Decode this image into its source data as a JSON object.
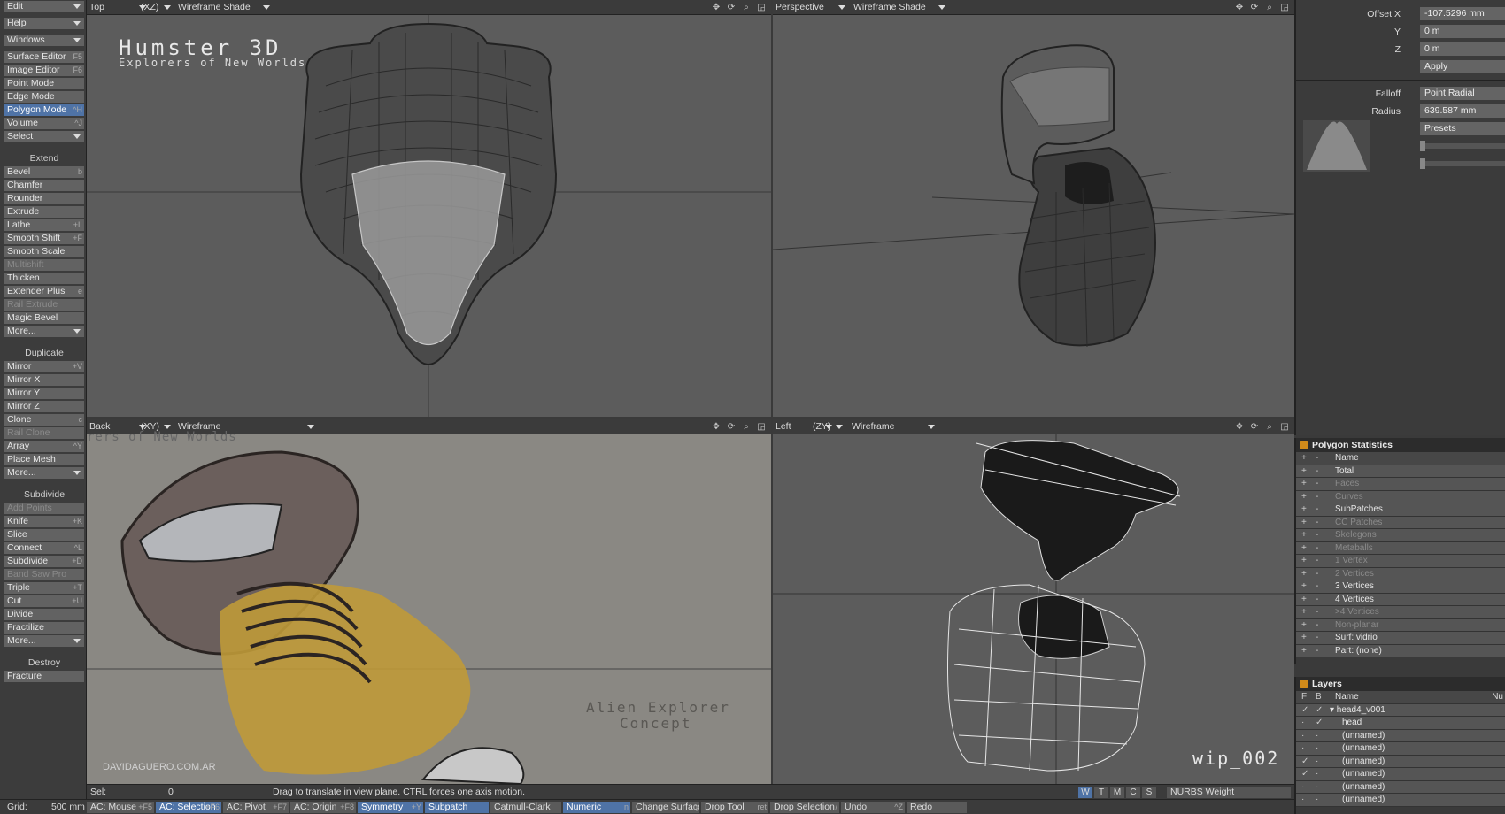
{
  "left_toolbar": {
    "items": [
      {
        "label": "Edit",
        "type": "dropdown"
      },
      {
        "label": "Help",
        "type": "dropdown"
      },
      {
        "label": "Windows",
        "type": "dropdown"
      },
      {
        "label": "Surface Editor",
        "shortcut": "F5"
      },
      {
        "label": "Image Editor",
        "shortcut": "F6"
      },
      {
        "label": "Point Mode",
        "shortcut": ""
      },
      {
        "label": "Edge Mode",
        "shortcut": ""
      },
      {
        "label": "Polygon Mode",
        "shortcut": "^H",
        "active": true
      },
      {
        "label": "Volume",
        "shortcut": "^J"
      },
      {
        "label": "Select",
        "type": "dropdown"
      },
      {
        "group": "Extend"
      },
      {
        "label": "Bevel",
        "shortcut": "b"
      },
      {
        "label": "Chamfer",
        "shortcut": ""
      },
      {
        "label": "Rounder",
        "shortcut": ""
      },
      {
        "label": "Extrude",
        "shortcut": ""
      },
      {
        "label": "Lathe",
        "shortcut": "+L"
      },
      {
        "label": "Smooth Shift",
        "shortcut": "+F"
      },
      {
        "label": "Smooth Scale",
        "shortcut": ""
      },
      {
        "label": "Multishift",
        "shortcut": "",
        "disabled": true
      },
      {
        "label": "Thicken",
        "shortcut": ""
      },
      {
        "label": "Extender Plus",
        "shortcut": "e"
      },
      {
        "label": "Rail Extrude",
        "shortcut": "",
        "disabled": true
      },
      {
        "label": "Magic Bevel",
        "shortcut": ""
      },
      {
        "label": "More...",
        "type": "dropdown"
      },
      {
        "group": "Duplicate"
      },
      {
        "label": "Mirror",
        "shortcut": "+V"
      },
      {
        "label": "Mirror X",
        "shortcut": ""
      },
      {
        "label": "Mirror Y",
        "shortcut": ""
      },
      {
        "label": "Mirror Z",
        "shortcut": ""
      },
      {
        "label": "Clone",
        "shortcut": "c"
      },
      {
        "label": "Rail Clone",
        "shortcut": "",
        "disabled": true
      },
      {
        "label": "Array",
        "shortcut": "^Y"
      },
      {
        "label": "Place Mesh",
        "shortcut": ""
      },
      {
        "label": "More...",
        "type": "dropdown"
      },
      {
        "group": "Subdivide"
      },
      {
        "label": "Add Points",
        "shortcut": "",
        "disabled": true
      },
      {
        "label": "Knife",
        "shortcut": "+K"
      },
      {
        "label": "Slice",
        "shortcut": ""
      },
      {
        "label": "Connect",
        "shortcut": "^L"
      },
      {
        "label": "Subdivide",
        "shortcut": "+D"
      },
      {
        "label": "Band Saw Pro",
        "shortcut": "",
        "disabled": true
      },
      {
        "label": "Triple",
        "shortcut": "+T"
      },
      {
        "label": "Cut",
        "shortcut": "+U"
      },
      {
        "label": "Divide",
        "shortcut": ""
      },
      {
        "label": "Fractilize",
        "shortcut": ""
      },
      {
        "label": "More...",
        "type": "dropdown"
      },
      {
        "group": "Destroy"
      },
      {
        "label": "Fracture",
        "shortcut": ""
      }
    ]
  },
  "viewports": {
    "top_left": {
      "name": "Top",
      "axes": "(XZ)",
      "shade": "Wireframe Shade",
      "title": "Humster 3D",
      "subtitle": "Explorers of New Worlds"
    },
    "top_right": {
      "name": "Perspective",
      "shade": "Wireframe Shade"
    },
    "bottom_left": {
      "name": "Back",
      "axes": "(XY)",
      "shade": "Wireframe",
      "watermark_top": "rers of New Worlds",
      "caption1": "Alien Explorer",
      "caption2": "Concept",
      "credit": "DAVIDAGUERO.COM.AR"
    },
    "bottom_right": {
      "name": "Left",
      "axes": "(ZY)",
      "shade": "Wireframe",
      "wip": "wip_002"
    }
  },
  "right_panel": {
    "offset_label": "Offset X",
    "offset_x": "-107.5296 mm",
    "y_label": "Y",
    "y": "0 m",
    "z_label": "Z",
    "z": "0 m",
    "apply": "Apply",
    "falloff_label": "Falloff",
    "falloff": "Point Radial",
    "radius_label": "Radius",
    "radius": "639.587 mm",
    "presets": "Presets"
  },
  "polygon_stats": {
    "title": "Polygon Statistics",
    "header": "Name",
    "rows": [
      {
        "name": "Total",
        "dim": false
      },
      {
        "name": "Faces",
        "dim": true
      },
      {
        "name": "Curves",
        "dim": true
      },
      {
        "name": "SubPatches",
        "dim": false
      },
      {
        "name": "CC Patches",
        "dim": true
      },
      {
        "name": "Skelegons",
        "dim": true
      },
      {
        "name": "Metaballs",
        "dim": true
      },
      {
        "name": "1 Vertex",
        "dim": true
      },
      {
        "name": "2 Vertices",
        "dim": true
      },
      {
        "name": "3 Vertices",
        "dim": false
      },
      {
        "name": "4 Vertices",
        "dim": false
      },
      {
        "name": ">4 Vertices",
        "dim": true
      },
      {
        "name": "Non-planar",
        "dim": true
      },
      {
        "name": "Surf: vidrio",
        "dim": false
      },
      {
        "name": "Part: (none)",
        "dim": false
      }
    ]
  },
  "layers": {
    "title": "Layers",
    "col_f": "F",
    "col_b": "B",
    "col_name": "Name",
    "col_num": "Nu",
    "rows": [
      {
        "name": "head4_v001",
        "f": "✓",
        "b": "✓"
      },
      {
        "name": "head",
        "f": "·",
        "b": "✓"
      },
      {
        "name": "(unnamed)",
        "f": "·",
        "b": "·"
      },
      {
        "name": "(unnamed)",
        "f": "·",
        "b": "·"
      },
      {
        "name": "(unnamed)",
        "f": "✓",
        "b": "·"
      },
      {
        "name": "(unnamed)",
        "f": "✓",
        "b": "·"
      },
      {
        "name": "(unnamed)",
        "f": "·",
        "b": "·"
      },
      {
        "name": "(unnamed)",
        "f": "·",
        "b": "·"
      }
    ]
  },
  "status": {
    "sel_label": "Sel:",
    "sel_value": "0",
    "message": "Drag to translate in view plane. CTRL forces one axis motion.",
    "modes": [
      "W",
      "T",
      "M",
      "C",
      "S"
    ],
    "nurbs": "NURBS Weight"
  },
  "bottom_bar": {
    "grid_label": "Grid:",
    "grid_value": "500 mm",
    "buttons": [
      {
        "label": "AC: Mouse",
        "shortcut": "+F5"
      },
      {
        "label": "AC: Selection",
        "shortcut": "+F6",
        "on": true
      },
      {
        "label": "AC: Pivot",
        "shortcut": "+F7"
      },
      {
        "label": "AC: Origin",
        "shortcut": "+F8"
      },
      {
        "label": "Symmetry",
        "shortcut": "+Y",
        "on": true
      },
      {
        "label": "Subpatch",
        "shortcut": "",
        "on": true
      },
      {
        "label": "Catmull-Clark",
        "shortcut": ""
      },
      {
        "label": "Numeric",
        "shortcut": "n",
        "on": true
      },
      {
        "label": "Change Surface",
        "shortcut": "q"
      },
      {
        "label": "Drop Tool",
        "shortcut": "ret"
      },
      {
        "label": "Drop Selection",
        "shortcut": "/"
      },
      {
        "label": "Undo",
        "shortcut": "^Z"
      },
      {
        "label": "Redo",
        "shortcut": ""
      }
    ]
  },
  "colors": {
    "active": "#4f73a6",
    "viewport": "#5c5c5c",
    "panel": "#3b3b3b"
  }
}
